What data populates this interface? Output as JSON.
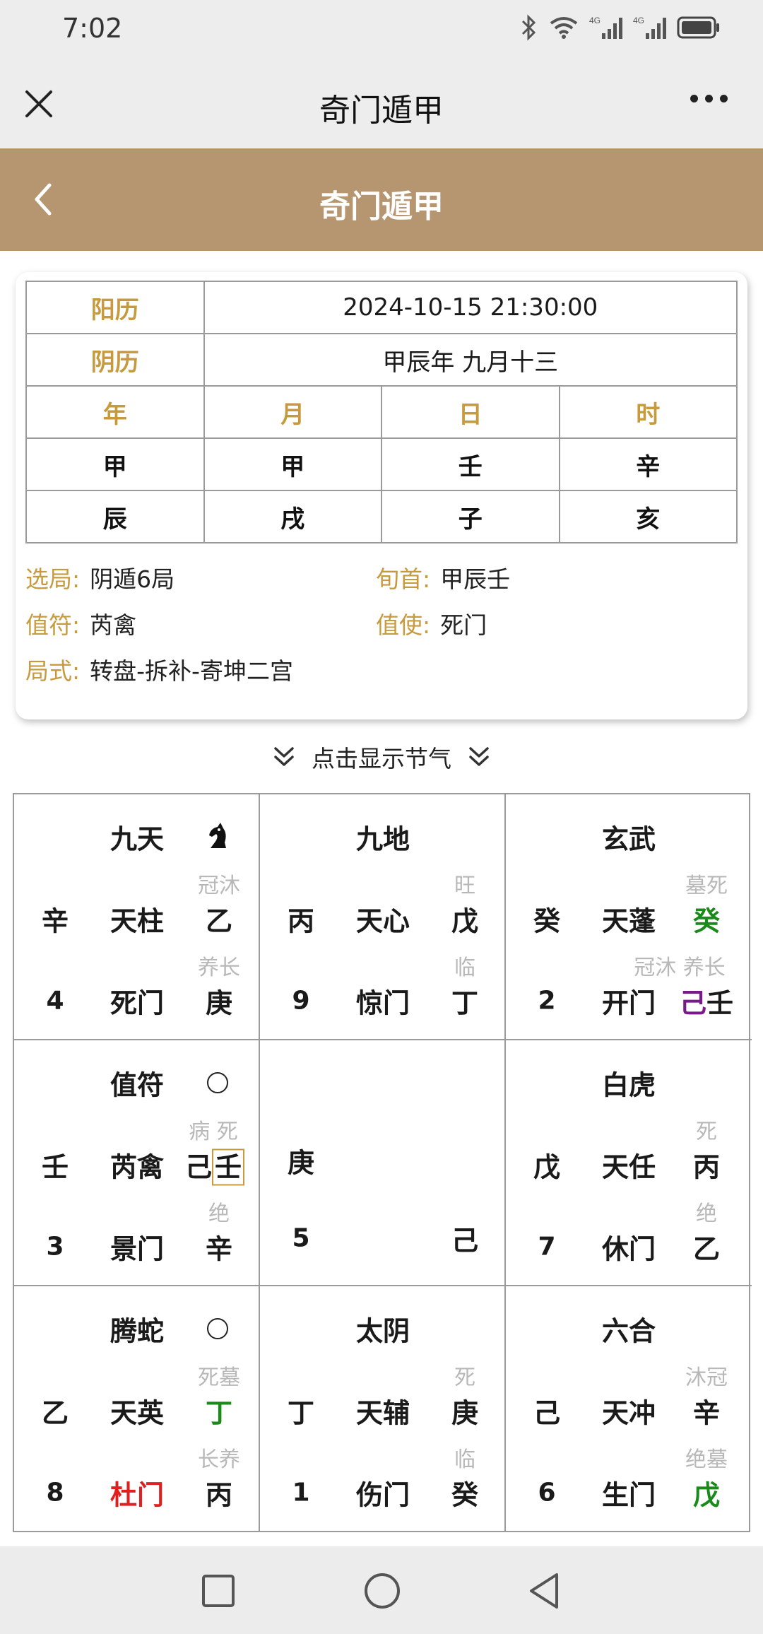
{
  "status": {
    "time": "7:02"
  },
  "wechat": {
    "title": "奇门遁甲"
  },
  "header": {
    "title": "奇门遁甲"
  },
  "info": {
    "solar_label": "阳历",
    "solar_value": "2024-10-15 21:30:00",
    "lunar_label": "阴历",
    "lunar_value": "甲辰年 九月十三",
    "pillar_headers": [
      "年",
      "月",
      "日",
      "时"
    ],
    "stems": [
      "甲",
      "甲",
      "壬",
      "辛"
    ],
    "branches": [
      "辰",
      "戌",
      "子",
      "亥"
    ],
    "ju_label": "选局:",
    "ju_value": "阴遁6局",
    "xun_label": "旬首:",
    "xun_value": "甲辰壬",
    "zhifu_label": "值符:",
    "zhifu_value": "芮禽",
    "zhishi_label": "值使:",
    "zhishi_value": "死门",
    "style_label": "局式:",
    "style_value": "转盘-拆补-寄坤二宫"
  },
  "toggle": {
    "label": "点击显示节气"
  },
  "palaces": [
    {
      "god": "九天",
      "mark": "horse-icon",
      "left_stem": "辛",
      "star": "天柱",
      "heaven_stem": "乙",
      "heaven_state": "冠沐",
      "num": "4",
      "gate": "死门",
      "earth_stem": "庚",
      "earth_state": "养长"
    },
    {
      "god": "九地",
      "left_stem": "丙",
      "star": "天心",
      "heaven_stem": "戊",
      "heaven_state": "旺",
      "num": "9",
      "gate": "惊门",
      "earth_stem": "丁",
      "earth_state": "临"
    },
    {
      "god": "玄武",
      "left_stem": "癸",
      "star": "天蓬",
      "heaven_stem": "癸",
      "heaven_state": "墓死",
      "num": "2",
      "gate": "开门",
      "earth_stem_a": "己",
      "earth_stem_b": "壬",
      "earth_state": "冠沐 养长"
    },
    {
      "god": "值符",
      "mark": "circle",
      "left_stem": "壬",
      "star": "芮禽",
      "heaven_stem_a": "己",
      "heaven_stem_b": "壬",
      "heaven_state": "病 死",
      "num": "3",
      "gate": "景门",
      "earth_stem": "辛",
      "earth_state": "绝"
    },
    {
      "left_stem": "庚",
      "num": "5",
      "earth_stem": "己"
    },
    {
      "god": "白虎",
      "left_stem": "戊",
      "star": "天任",
      "heaven_stem": "丙",
      "heaven_state": "死",
      "num": "7",
      "gate": "休门",
      "earth_stem": "乙",
      "earth_state": "绝"
    },
    {
      "god": "腾蛇",
      "mark": "circle",
      "left_stem": "乙",
      "star": "天英",
      "heaven_stem": "丁",
      "heaven_state": "死墓",
      "num": "8",
      "gate": "杜门",
      "earth_stem": "丙",
      "earth_state": "长养"
    },
    {
      "god": "太阴",
      "left_stem": "丁",
      "star": "天辅",
      "heaven_stem": "庚",
      "heaven_state": "死",
      "num": "1",
      "gate": "伤门",
      "earth_stem": "癸",
      "earth_state": "临"
    },
    {
      "god": "六合",
      "left_stem": "己",
      "star": "天冲",
      "heaven_stem": "辛",
      "heaven_state": "沐冠",
      "num": "6",
      "gate": "生门",
      "earth_stem": "戊",
      "earth_state": "绝墓"
    }
  ],
  "colors": {
    "header_bg": "#b59671",
    "label_gold": "#c79a3d",
    "red": "#e02020",
    "green": "#1a8a1a",
    "purple": "#7a1a8a"
  }
}
